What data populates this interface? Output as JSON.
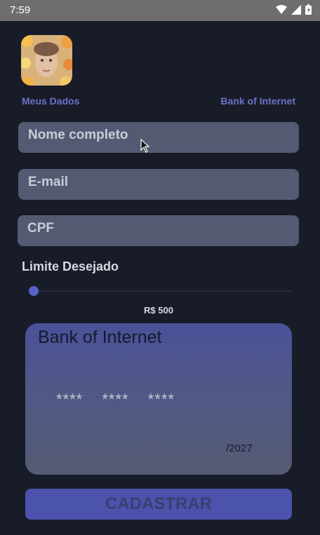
{
  "status_bar": {
    "time": "7:59",
    "icons": [
      "wifi-icon",
      "signal-icon",
      "battery-icon"
    ]
  },
  "header": {
    "left_link": "Meus Dados",
    "right_link": "Bank of Internet"
  },
  "form": {
    "name_placeholder": "Nome completo",
    "email_placeholder": "E-mail",
    "cpf_placeholder": "CPF",
    "limit_label": "Limite Desejado",
    "limit_value": "R$ 500",
    "limit_slider_fraction": 0.0
  },
  "card": {
    "bank_name": "Bank of Internet",
    "number": "****  ****  ****",
    "expiry": "/2027"
  },
  "submit_label": "CADASTRAR",
  "colors": {
    "background": "#181c28",
    "accent": "#5861c6",
    "field_bg": "#535a72"
  }
}
